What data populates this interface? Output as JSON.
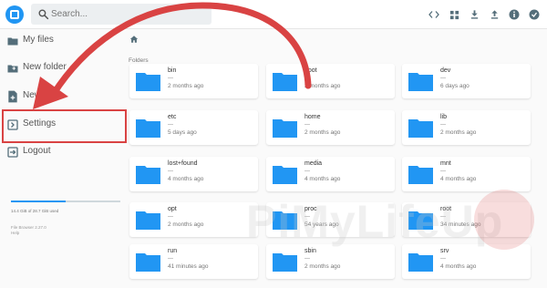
{
  "header": {
    "search_placeholder": "Search...",
    "actions": [
      "code-icon",
      "grid-view-icon",
      "download-icon",
      "upload-icon",
      "info-icon",
      "check-circle-icon"
    ]
  },
  "sidebar": {
    "items": [
      {
        "label": "My files",
        "icon": "folder-icon"
      },
      {
        "label": "New folder",
        "icon": "new-folder-icon"
      },
      {
        "label": "New file",
        "icon": "new-file-icon"
      },
      {
        "label": "Settings",
        "icon": "settings-icon"
      },
      {
        "label": "Logout",
        "icon": "logout-icon"
      }
    ],
    "storage_text": "14.4 GiB of 28.7 GiB used",
    "storage_used_fraction": 0.5,
    "version_text": "File Browser 2.27.0",
    "help_text": "Help"
  },
  "main": {
    "section_label": "Folders",
    "folders": [
      {
        "name": "bin",
        "size": "—",
        "date": "2 months ago"
      },
      {
        "name": "boot",
        "size": "—",
        "date": "2 months ago"
      },
      {
        "name": "dev",
        "size": "—",
        "date": "6 days ago"
      },
      {
        "name": "etc",
        "size": "—",
        "date": "5 days ago"
      },
      {
        "name": "home",
        "size": "—",
        "date": "2 months ago"
      },
      {
        "name": "lib",
        "size": "—",
        "date": "2 months ago"
      },
      {
        "name": "lost+found",
        "size": "—",
        "date": "4 months ago"
      },
      {
        "name": "media",
        "size": "—",
        "date": "4 months ago"
      },
      {
        "name": "mnt",
        "size": "—",
        "date": "4 months ago"
      },
      {
        "name": "opt",
        "size": "—",
        "date": "2 months ago"
      },
      {
        "name": "proc",
        "size": "—",
        "date": "54 years ago"
      },
      {
        "name": "root",
        "size": "—",
        "date": "34 minutes ago"
      },
      {
        "name": "run",
        "size": "—",
        "date": "41 minutes ago"
      },
      {
        "name": "sbin",
        "size": "—",
        "date": "2 months ago"
      },
      {
        "name": "srv",
        "size": "—",
        "date": "4 months ago"
      }
    ]
  },
  "watermark": "PiMyLifeUp",
  "colors": {
    "accent": "#2196f3",
    "highlight": "#d94343",
    "folder": "#2196f3"
  }
}
